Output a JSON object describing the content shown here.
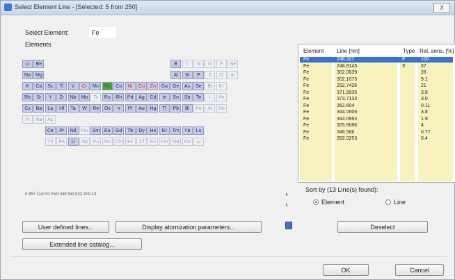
{
  "window": {
    "title": "Select Element Line - [Selected: 5 from 250]",
    "close_label": "X"
  },
  "select_element": {
    "label": "Select Element:",
    "value": "Fe"
  },
  "elements_label": "Elements",
  "periodic_cells": [
    {
      "sym": "Li",
      "c": 2,
      "r": 0,
      "s": "n"
    },
    {
      "sym": "Be",
      "c": 3,
      "r": 0,
      "s": "n"
    },
    {
      "sym": "B",
      "c": 15,
      "r": 0,
      "s": "n"
    },
    {
      "sym": "C",
      "c": 16,
      "r": 0,
      "s": "g"
    },
    {
      "sym": "N",
      "c": 17,
      "r": 0,
      "s": "g"
    },
    {
      "sym": "O",
      "c": 18,
      "r": 0,
      "s": "g"
    },
    {
      "sym": "F",
      "c": 19,
      "r": 0,
      "s": "g"
    },
    {
      "sym": "Ne",
      "c": 20,
      "r": 0,
      "s": "g"
    },
    {
      "sym": "Na",
      "c": 2,
      "r": 1,
      "s": "n"
    },
    {
      "sym": "Mg",
      "c": 3,
      "r": 1,
      "s": "n"
    },
    {
      "sym": "Al",
      "c": 15,
      "r": 1,
      "s": "n"
    },
    {
      "sym": "Si",
      "c": 16,
      "r": 1,
      "s": "n"
    },
    {
      "sym": "P",
      "c": 17,
      "r": 1,
      "s": "n"
    },
    {
      "sym": "S",
      "c": 18,
      "r": 1,
      "s": "g"
    },
    {
      "sym": "Cl",
      "c": 19,
      "r": 1,
      "s": "g"
    },
    {
      "sym": "Ar",
      "c": 20,
      "r": 1,
      "s": "g"
    },
    {
      "sym": "K",
      "c": 2,
      "r": 2,
      "s": "n"
    },
    {
      "sym": "Ca",
      "c": 3,
      "r": 2,
      "s": "n"
    },
    {
      "sym": "Sc",
      "c": 4,
      "r": 2,
      "s": "n"
    },
    {
      "sym": "Ti",
      "c": 5,
      "r": 2,
      "s": "n"
    },
    {
      "sym": "V",
      "c": 6,
      "r": 2,
      "s": "n"
    },
    {
      "sym": "Cr",
      "c": 7,
      "r": 2,
      "s": "r"
    },
    {
      "sym": "Mn",
      "c": 8,
      "r": 2,
      "s": "n"
    },
    {
      "sym": "Fe",
      "c": 9,
      "r": 2,
      "s": "x"
    },
    {
      "sym": "Co",
      "c": 10,
      "r": 2,
      "s": "n"
    },
    {
      "sym": "Ni",
      "c": 11,
      "r": 2,
      "s": "r"
    },
    {
      "sym": "Cu",
      "c": 12,
      "r": 2,
      "s": "r"
    },
    {
      "sym": "Zn",
      "c": 13,
      "r": 2,
      "s": "r"
    },
    {
      "sym": "Ga",
      "c": 14,
      "r": 2,
      "s": "n"
    },
    {
      "sym": "Ge",
      "c": 15,
      "r": 2,
      "s": "n"
    },
    {
      "sym": "As",
      "c": 16,
      "r": 2,
      "s": "n"
    },
    {
      "sym": "Se",
      "c": 17,
      "r": 2,
      "s": "n"
    },
    {
      "sym": "Br",
      "c": 18,
      "r": 2,
      "s": "g"
    },
    {
      "sym": "Kr",
      "c": 19,
      "r": 2,
      "s": "g"
    },
    {
      "sym": "Rb",
      "c": 2,
      "r": 3,
      "s": "n"
    },
    {
      "sym": "Sr",
      "c": 3,
      "r": 3,
      "s": "n"
    },
    {
      "sym": "Y",
      "c": 4,
      "r": 3,
      "s": "n"
    },
    {
      "sym": "Zr",
      "c": 5,
      "r": 3,
      "s": "n"
    },
    {
      "sym": "Nb",
      "c": 6,
      "r": 3,
      "s": "n"
    },
    {
      "sym": "Mo",
      "c": 7,
      "r": 3,
      "s": "n"
    },
    {
      "sym": "Tc",
      "c": 8,
      "r": 3,
      "s": "g"
    },
    {
      "sym": "Ru",
      "c": 9,
      "r": 3,
      "s": "n"
    },
    {
      "sym": "Rh",
      "c": 10,
      "r": 3,
      "s": "n"
    },
    {
      "sym": "Pd",
      "c": 11,
      "r": 3,
      "s": "n"
    },
    {
      "sym": "Ag",
      "c": 12,
      "r": 3,
      "s": "n"
    },
    {
      "sym": "Cd",
      "c": 13,
      "r": 3,
      "s": "n"
    },
    {
      "sym": "In",
      "c": 14,
      "r": 3,
      "s": "n"
    },
    {
      "sym": "Sn",
      "c": 15,
      "r": 3,
      "s": "n"
    },
    {
      "sym": "Sb",
      "c": 16,
      "r": 3,
      "s": "n"
    },
    {
      "sym": "Te",
      "c": 17,
      "r": 3,
      "s": "n"
    },
    {
      "sym": "I",
      "c": 18,
      "r": 3,
      "s": "g"
    },
    {
      "sym": "Xe",
      "c": 19,
      "r": 3,
      "s": "g"
    },
    {
      "sym": "Cs",
      "c": 2,
      "r": 4,
      "s": "n"
    },
    {
      "sym": "Ba",
      "c": 3,
      "r": 4,
      "s": "n"
    },
    {
      "sym": "La",
      "c": 4,
      "r": 4,
      "s": "n"
    },
    {
      "sym": "Hf",
      "c": 5,
      "r": 4,
      "s": "n"
    },
    {
      "sym": "Ta",
      "c": 6,
      "r": 4,
      "s": "n"
    },
    {
      "sym": "W",
      "c": 7,
      "r": 4,
      "s": "n"
    },
    {
      "sym": "Re",
      "c": 8,
      "r": 4,
      "s": "n"
    },
    {
      "sym": "Os",
      "c": 9,
      "r": 4,
      "s": "n"
    },
    {
      "sym": "Ir",
      "c": 10,
      "r": 4,
      "s": "n"
    },
    {
      "sym": "Pt",
      "c": 11,
      "r": 4,
      "s": "n"
    },
    {
      "sym": "Au",
      "c": 12,
      "r": 4,
      "s": "n"
    },
    {
      "sym": "Hg",
      "c": 13,
      "r": 4,
      "s": "n"
    },
    {
      "sym": "Tl",
      "c": 14,
      "r": 4,
      "s": "n"
    },
    {
      "sym": "Pb",
      "c": 15,
      "r": 4,
      "s": "n"
    },
    {
      "sym": "Bi",
      "c": 16,
      "r": 4,
      "s": "n"
    },
    {
      "sym": "Po",
      "c": 17,
      "r": 4,
      "s": "g"
    },
    {
      "sym": "At",
      "c": 18,
      "r": 4,
      "s": "g"
    },
    {
      "sym": "Rn",
      "c": 19,
      "r": 4,
      "s": "g"
    },
    {
      "sym": "Fr",
      "c": 2,
      "r": 5,
      "s": "g"
    },
    {
      "sym": "Ra",
      "c": 3,
      "r": 5,
      "s": "g"
    },
    {
      "sym": "Ac",
      "c": 4,
      "r": 5,
      "s": "g"
    },
    {
      "sym": "Ce",
      "c": 4,
      "r": 6,
      "s": "n"
    },
    {
      "sym": "Pr",
      "c": 5,
      "r": 6,
      "s": "n"
    },
    {
      "sym": "Nd",
      "c": 6,
      "r": 6,
      "s": "n"
    },
    {
      "sym": "Pm",
      "c": 7,
      "r": 6,
      "s": "g"
    },
    {
      "sym": "Sm",
      "c": 8,
      "r": 6,
      "s": "n"
    },
    {
      "sym": "Eu",
      "c": 9,
      "r": 6,
      "s": "n"
    },
    {
      "sym": "Gd",
      "c": 10,
      "r": 6,
      "s": "n"
    },
    {
      "sym": "Tb",
      "c": 11,
      "r": 6,
      "s": "n"
    },
    {
      "sym": "Dy",
      "c": 12,
      "r": 6,
      "s": "n"
    },
    {
      "sym": "Ho",
      "c": 13,
      "r": 6,
      "s": "n"
    },
    {
      "sym": "Er",
      "c": 14,
      "r": 6,
      "s": "n"
    },
    {
      "sym": "Tm",
      "c": 15,
      "r": 6,
      "s": "n"
    },
    {
      "sym": "Yb",
      "c": 16,
      "r": 6,
      "s": "n"
    },
    {
      "sym": "Lu",
      "c": 17,
      "r": 6,
      "s": "n"
    },
    {
      "sym": "Th",
      "c": 4,
      "r": 7,
      "s": "g"
    },
    {
      "sym": "Pa",
      "c": 5,
      "r": 7,
      "s": "g"
    },
    {
      "sym": "U",
      "c": 6,
      "r": 7,
      "s": "n"
    },
    {
      "sym": "Np",
      "c": 7,
      "r": 7,
      "s": "g"
    },
    {
      "sym": "Pu",
      "c": 8,
      "r": 7,
      "s": "g"
    },
    {
      "sym": "Am",
      "c": 9,
      "r": 7,
      "s": "g"
    },
    {
      "sym": "Cm",
      "c": 10,
      "r": 7,
      "s": "g"
    },
    {
      "sym": "Bk",
      "c": 11,
      "r": 7,
      "s": "g"
    },
    {
      "sym": "Cf",
      "c": 12,
      "r": 7,
      "s": "g"
    },
    {
      "sym": "Es",
      "c": 13,
      "r": 7,
      "s": "g"
    },
    {
      "sym": "Fm",
      "c": 14,
      "r": 7,
      "s": "g"
    },
    {
      "sym": "Md",
      "c": 15,
      "r": 7,
      "s": "g"
    },
    {
      "sym": "No",
      "c": 16,
      "r": 7,
      "s": "g"
    },
    {
      "sym": "Lr",
      "c": 17,
      "r": 7,
      "s": "g"
    }
  ],
  "composition_text": "0.957 Cu0.01 Fe0.048 Ni0.032 Zn0.13",
  "line_table": {
    "headers": [
      "Element",
      "Line [nm]",
      "Type",
      "Rel. sens. [%]"
    ],
    "rows": [
      [
        "Fe",
        "248.327",
        "P",
        "100"
      ],
      [
        "Fe",
        "248.8143",
        "S",
        "67"
      ],
      [
        "Fe",
        "302.0639",
        "",
        "26"
      ],
      [
        "Fe",
        "302.1073",
        "",
        "9.1"
      ],
      [
        "Fe",
        "252.7435",
        "",
        "21"
      ],
      [
        "Fe",
        "371.9935",
        "",
        "3.8"
      ],
      [
        "Fe",
        "373.7133",
        "",
        "3.0"
      ],
      [
        "Fe",
        "352.604",
        "",
        "0.11"
      ],
      [
        "Fe",
        "344.0606",
        "",
        "3.8"
      ],
      [
        "Fe",
        "344.0993",
        "",
        "1.9"
      ],
      [
        "Fe",
        "305.9086",
        "",
        "4"
      ],
      [
        "Fe",
        "346.586",
        "",
        "0.77"
      ],
      [
        "Fe",
        "392.0253",
        "",
        "0.4"
      ]
    ]
  },
  "sort": {
    "label": "Sort by (13 Line(s) found):",
    "options": [
      "Element",
      "Line"
    ],
    "selected": "Element"
  },
  "buttons": {
    "user_defined": "User defined lines...",
    "display_params": "Display atomization parameters...",
    "deselect": "Deselect",
    "extended_catalog": "Extended line catalog...",
    "ok": "OK",
    "cancel": "Cancel"
  }
}
